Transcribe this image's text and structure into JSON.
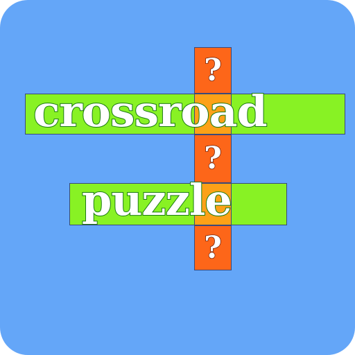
{
  "app_icon": {
    "background_color": "#64a6f8",
    "word_bar_color": "#88f224",
    "column_orange_color": "#fd6619",
    "column_amber_color": "#fda117",
    "words": {
      "crossroad": "crossroad",
      "puzzle": "puzzle"
    },
    "column_cells": [
      {
        "glyph": "?",
        "color": "orange"
      },
      {
        "glyph": "",
        "color": "amber"
      },
      {
        "glyph": "?",
        "color": "orange"
      },
      {
        "glyph": "",
        "color": "amber"
      },
      {
        "glyph": "?",
        "color": "orange"
      }
    ]
  }
}
